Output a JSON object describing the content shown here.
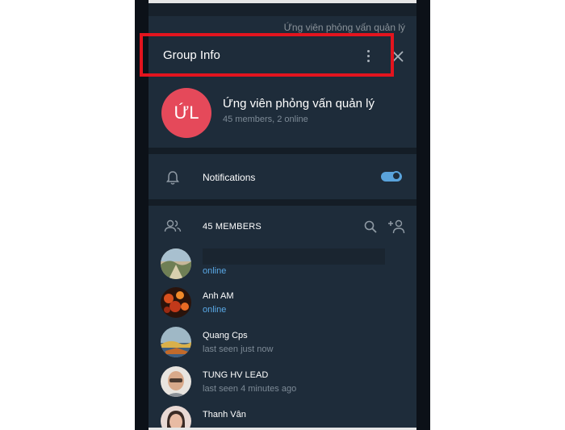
{
  "background_chat": {
    "title": "Ứng viên phỏng vấn quản lý"
  },
  "header": {
    "title": "Group Info",
    "menu_icon": "kebab-vertical-icon",
    "close_icon": "close-icon"
  },
  "group": {
    "initials": "ỨL",
    "name": "Ứng viên phỏng vấn quản lý",
    "stats": "45 members, 2 online",
    "avatar_color": "#e5495a"
  },
  "notifications": {
    "label": "Notifications",
    "enabled": true
  },
  "members": {
    "header_label": "45 MEMBERS",
    "list": [
      {
        "name": "",
        "status": "online",
        "status_type": "online"
      },
      {
        "name": "Anh AM",
        "status": "online",
        "status_type": "online"
      },
      {
        "name": "Quang Cps",
        "status": "last seen just now",
        "status_type": "seen"
      },
      {
        "name": "TUNG HV LEAD",
        "status": "last seen 4 minutes ago",
        "status_type": "seen"
      },
      {
        "name": "Thanh Vân",
        "status": "",
        "status_type": "seen"
      }
    ]
  },
  "colors": {
    "panel_bg": "#1e2c3a",
    "accent": "#5aa9e6",
    "highlight_box": "#e3141e"
  }
}
